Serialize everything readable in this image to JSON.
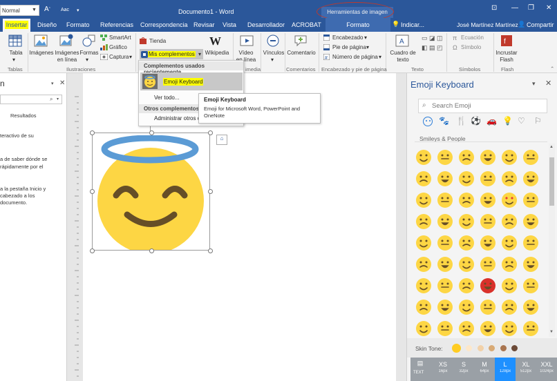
{
  "titlebar": {
    "style_value": "Normal",
    "doc_title": "Documento1 - Word",
    "tools_label": "Herramientas de imagen"
  },
  "tabs": {
    "insert": "Insertar",
    "items": [
      "Diseño",
      "Formato",
      "Referencias",
      "Correspondencia",
      "Revisar",
      "Vista",
      "Desarrollador",
      "ACROBAT"
    ],
    "formato_tools": "Formato",
    "tell_me": "Indicar...",
    "user": "José Martínez Martínez",
    "share": "Compartir"
  },
  "ribbon": {
    "tabla": "Tabla",
    "imagenes": "Imágenes",
    "imagenes_linea": "Imágenes en línea",
    "formas": "Formas",
    "smartart": "SmartArt",
    "grafico": "Gráfico",
    "captura": "Captura",
    "tienda": "Tienda",
    "mis_complementos": "Mis complementos",
    "wikipedia": "Wikipedia",
    "video": "Vídeo en línea",
    "vinculos": "Vínculos",
    "comentario": "Comentario",
    "encabezado": "Encabezado",
    "pie_pagina": "Pie de página",
    "numero_pagina": "Número de página",
    "cuadro_texto": "Cuadro de texto",
    "ecuacion": "Ecuación",
    "simbolo": "Símbolo",
    "incrustar_flash": "Incrustar Flash",
    "groups": {
      "tablas": "Tablas",
      "ilustraciones": "Ilustraciones",
      "multimedia": "imedia",
      "comentarios": "Comentarios",
      "encabezado_pie": "Encabezado y pie de página",
      "texto": "Texto",
      "simbolos": "Símbolos",
      "flash": "Flash"
    }
  },
  "dropdown": {
    "recent_header": "Complementos usados recientemente",
    "emoji_item": "Emoji Keyboard",
    "ver_todo": "Ver todo...",
    "others_header": "Otros complementos",
    "admin": "Administrar otros c"
  },
  "tooltip": {
    "title": "Emoji Keyboard",
    "body": "Emoji for Microsoft Word, PowerPoint and OneNote"
  },
  "nav": {
    "title": "n",
    "search_value": "",
    "results": "Resultados",
    "p1": "teractivo de su",
    "p2a": "a de saber dónde se",
    "p2b": "rápidamente por el",
    "p2c": "",
    "p3a": "a la pestaña Inicio y",
    "p3b": "cabezado a los",
    "p3c": "documento."
  },
  "emoji_pane": {
    "title": "Emoji Keyboard",
    "search_placeholder": "Search Emoji",
    "section": "Smileys & People",
    "skin_tone_label": "Skin Tone:",
    "skin_tones": [
      "#ffcc22",
      "#fde7c9",
      "#f2d1a8",
      "#d8aa75",
      "#a9754f",
      "#6c4a37"
    ],
    "sizes": [
      {
        "label": "XS",
        "sub": "16px",
        "active": false
      },
      {
        "label": "S",
        "sub": "32px",
        "active": false
      },
      {
        "label": "M",
        "sub": "64px",
        "active": false
      },
      {
        "label": "L",
        "sub": "128px",
        "active": true
      },
      {
        "label": "XL",
        "sub": "512px",
        "active": false
      },
      {
        "label": "XXL",
        "sub": "1024px",
        "active": false
      }
    ],
    "text_size_label": "TEXT",
    "emoji_rows": 9,
    "emoji_cols": 6
  },
  "colors": {
    "word_blue": "#2b579a",
    "highlight_yellow": "#ffff00",
    "emoji_yellow": "#fdd644",
    "halo_blue": "#5b9bd5",
    "active_size": "#1e90ff"
  }
}
